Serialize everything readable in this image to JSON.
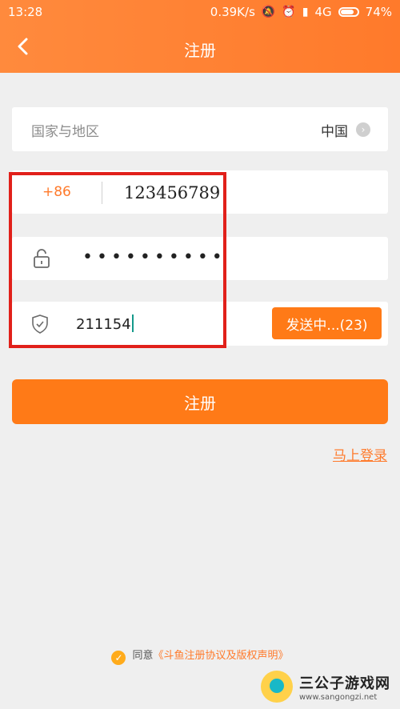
{
  "status": {
    "time": "13:28",
    "network_speed": "0.39K/s",
    "network_type": "4G",
    "battery": "74%",
    "icons": [
      "mute-icon",
      "alarm-icon",
      "signal-icon",
      "battery-icon"
    ]
  },
  "header": {
    "title": "注册"
  },
  "form": {
    "region_label": "国家与地区",
    "region_value": "中国",
    "country_code": "+86",
    "phone_value": "123456789",
    "password_mask": "••••••••••",
    "verification_code": "211154",
    "send_button": "发送中...(23)"
  },
  "actions": {
    "register": "注册",
    "login_link": "马上登录"
  },
  "agreement": {
    "prefix": "同意",
    "link": "《斗鱼注册协议及版权声明》"
  },
  "watermark": {
    "title": "三公子游戏网",
    "url": "www.sangongzi.net"
  },
  "colors": {
    "accent": "#ff7a17",
    "highlight": "#e1201a",
    "background": "#efefef"
  }
}
